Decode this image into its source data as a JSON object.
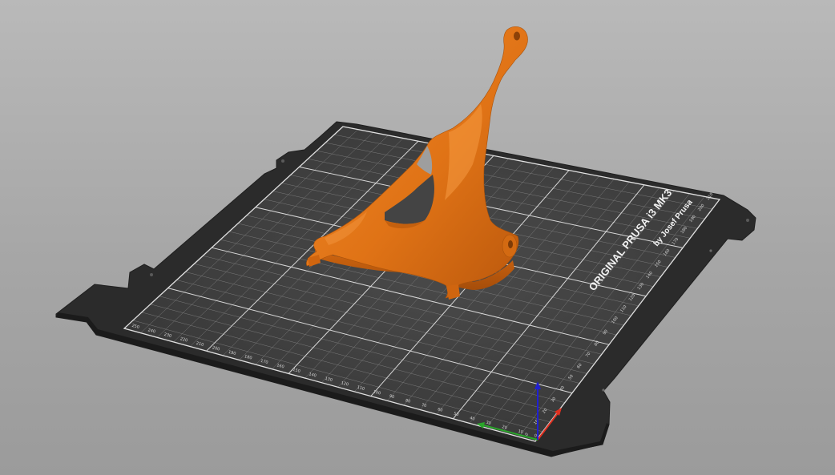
{
  "bed": {
    "brand_text": "ORIGINAL PRUSA i3 MK3",
    "author_text": "by Josef Prusa",
    "x_ticks": [
      "250",
      "240",
      "230",
      "220",
      "210",
      "200",
      "190",
      "180",
      "170",
      "160",
      "150",
      "140",
      "130",
      "120",
      "110",
      "100",
      "90",
      "80",
      "70",
      "60",
      "50",
      "40",
      "30",
      "20",
      "10",
      "0"
    ],
    "y_ticks": [
      "0",
      "10",
      "20",
      "30",
      "40",
      "50",
      "60",
      "70",
      "80",
      "90",
      "100",
      "110",
      "120",
      "130",
      "140",
      "150",
      "160",
      "170",
      "180",
      "190",
      "200",
      "210"
    ]
  },
  "model": {
    "name": "",
    "color": "#e07316"
  },
  "axes": {
    "x_color": "#e03020",
    "y_color": "#2aa62a",
    "z_color": "#2020d0"
  },
  "colors": {
    "background_top": "#b9b9b9",
    "background_bottom": "#9b9b9b",
    "bed_frame": "#2b2b2b",
    "bed_surface": "#3f3f3f",
    "grid_major": "#d8d8d8",
    "grid_minor": "#7a7a7a"
  }
}
